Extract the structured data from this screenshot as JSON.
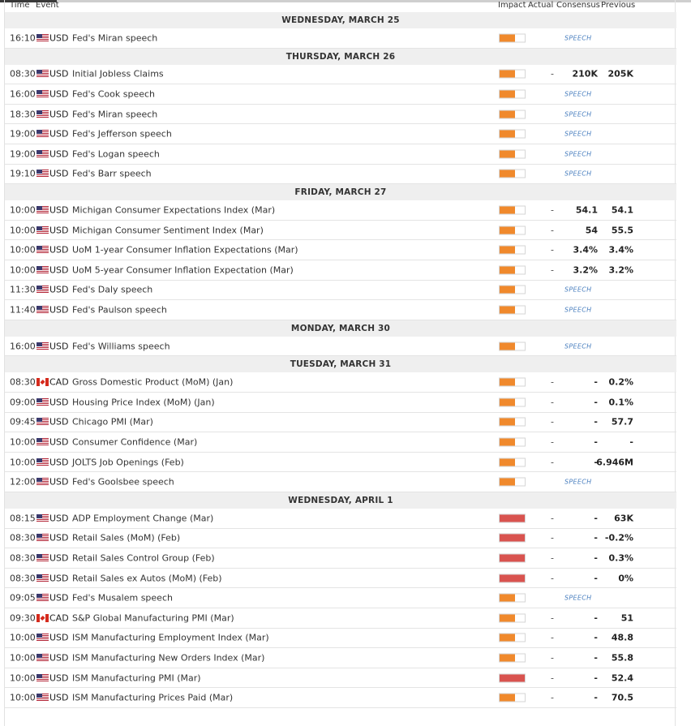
{
  "header": {
    "time": "Time",
    "event": "Event",
    "impact": "Impact",
    "actual": "Actual",
    "consensus": "Consensus",
    "previous": "Previous"
  },
  "colors": {
    "impact_medium": "#f0892c",
    "impact_high": "#d9534f",
    "speech_tag": "#4a7fbf",
    "day_header_bg": "#efefef"
  },
  "calendar": [
    {
      "type": "day",
      "label": "WEDNESDAY, MARCH 25"
    },
    {
      "type": "event",
      "time": "16:10",
      "flag": "us-flag-icon",
      "currency": "USD",
      "event": "Fed's Miran speech",
      "impact": "medium",
      "impact_level": 0.6,
      "actual": "",
      "consensus": "",
      "previous": "",
      "tag": "SPEECH"
    },
    {
      "type": "day",
      "label": "THURSDAY, MARCH 26"
    },
    {
      "type": "event",
      "time": "08:30",
      "flag": "us-flag-icon",
      "currency": "USD",
      "event": "Initial Jobless Claims",
      "impact": "medium",
      "impact_level": 0.6,
      "actual": "-",
      "consensus": "210K",
      "previous": "205K",
      "tag": ""
    },
    {
      "type": "event",
      "time": "16:00",
      "flag": "us-flag-icon",
      "currency": "USD",
      "event": "Fed's Cook speech",
      "impact": "medium",
      "impact_level": 0.6,
      "actual": "",
      "consensus": "",
      "previous": "",
      "tag": "SPEECH"
    },
    {
      "type": "event",
      "time": "18:30",
      "flag": "us-flag-icon",
      "currency": "USD",
      "event": "Fed's Miran speech",
      "impact": "medium",
      "impact_level": 0.6,
      "actual": "",
      "consensus": "",
      "previous": "",
      "tag": "SPEECH"
    },
    {
      "type": "event",
      "time": "19:00",
      "flag": "us-flag-icon",
      "currency": "USD",
      "event": "Fed's Jefferson speech",
      "impact": "medium",
      "impact_level": 0.6,
      "actual": "",
      "consensus": "",
      "previous": "",
      "tag": "SPEECH"
    },
    {
      "type": "event",
      "time": "19:00",
      "flag": "us-flag-icon",
      "currency": "USD",
      "event": "Fed's Logan speech",
      "impact": "medium",
      "impact_level": 0.6,
      "actual": "",
      "consensus": "",
      "previous": "",
      "tag": "SPEECH"
    },
    {
      "type": "event",
      "time": "19:10",
      "flag": "us-flag-icon",
      "currency": "USD",
      "event": "Fed's Barr speech",
      "impact": "medium",
      "impact_level": 0.6,
      "actual": "",
      "consensus": "",
      "previous": "",
      "tag": "SPEECH"
    },
    {
      "type": "day",
      "label": "FRIDAY, MARCH 27"
    },
    {
      "type": "event",
      "time": "10:00",
      "flag": "us-flag-icon",
      "currency": "USD",
      "event": "Michigan Consumer Expectations Index (Mar)",
      "impact": "medium",
      "impact_level": 0.6,
      "actual": "-",
      "consensus": "54.1",
      "previous": "54.1",
      "tag": ""
    },
    {
      "type": "event",
      "time": "10:00",
      "flag": "us-flag-icon",
      "currency": "USD",
      "event": "Michigan Consumer Sentiment Index (Mar)",
      "impact": "medium",
      "impact_level": 0.6,
      "actual": "-",
      "consensus": "54",
      "previous": "55.5",
      "tag": ""
    },
    {
      "type": "event",
      "time": "10:00",
      "flag": "us-flag-icon",
      "currency": "USD",
      "event": "UoM 1-year Consumer Inflation Expectations (Mar)",
      "impact": "medium",
      "impact_level": 0.6,
      "actual": "-",
      "consensus": "3.4%",
      "previous": "3.4%",
      "tag": ""
    },
    {
      "type": "event",
      "time": "10:00",
      "flag": "us-flag-icon",
      "currency": "USD",
      "event": "UoM 5-year Consumer Inflation Expectation (Mar)",
      "impact": "medium",
      "impact_level": 0.6,
      "actual": "-",
      "consensus": "3.2%",
      "previous": "3.2%",
      "tag": ""
    },
    {
      "type": "event",
      "time": "11:30",
      "flag": "us-flag-icon",
      "currency": "USD",
      "event": "Fed's Daly speech",
      "impact": "medium",
      "impact_level": 0.6,
      "actual": "",
      "consensus": "",
      "previous": "",
      "tag": "SPEECH"
    },
    {
      "type": "event",
      "time": "11:40",
      "flag": "us-flag-icon",
      "currency": "USD",
      "event": "Fed's Paulson speech",
      "impact": "medium",
      "impact_level": 0.6,
      "actual": "",
      "consensus": "",
      "previous": "",
      "tag": "SPEECH"
    },
    {
      "type": "day",
      "label": "MONDAY, MARCH 30"
    },
    {
      "type": "event",
      "time": "16:00",
      "flag": "us-flag-icon",
      "currency": "USD",
      "event": "Fed's Williams speech",
      "impact": "medium",
      "impact_level": 0.6,
      "actual": "",
      "consensus": "",
      "previous": "",
      "tag": "SPEECH"
    },
    {
      "type": "day",
      "label": "TUESDAY, MARCH 31"
    },
    {
      "type": "event",
      "time": "08:30",
      "flag": "ca-flag-icon",
      "currency": "CAD",
      "event": "Gross Domestic Product (MoM) (Jan)",
      "impact": "medium",
      "impact_level": 0.6,
      "actual": "-",
      "consensus": "-",
      "previous": "0.2%",
      "tag": ""
    },
    {
      "type": "event",
      "time": "09:00",
      "flag": "us-flag-icon",
      "currency": "USD",
      "event": "Housing Price Index (MoM) (Jan)",
      "impact": "medium",
      "impact_level": 0.6,
      "actual": "-",
      "consensus": "-",
      "previous": "0.1%",
      "tag": ""
    },
    {
      "type": "event",
      "time": "09:45",
      "flag": "us-flag-icon",
      "currency": "USD",
      "event": "Chicago PMI (Mar)",
      "impact": "medium",
      "impact_level": 0.6,
      "actual": "-",
      "consensus": "-",
      "previous": "57.7",
      "tag": ""
    },
    {
      "type": "event",
      "time": "10:00",
      "flag": "us-flag-icon",
      "currency": "USD",
      "event": "Consumer Confidence (Mar)",
      "impact": "medium",
      "impact_level": 0.6,
      "actual": "-",
      "consensus": "-",
      "previous": "-",
      "tag": ""
    },
    {
      "type": "event",
      "time": "10:00",
      "flag": "us-flag-icon",
      "currency": "USD",
      "event": "JOLTS Job Openings (Feb)",
      "impact": "medium",
      "impact_level": 0.6,
      "actual": "-",
      "consensus": "-",
      "previous": "6.946M",
      "tag": ""
    },
    {
      "type": "event",
      "time": "12:00",
      "flag": "us-flag-icon",
      "currency": "USD",
      "event": "Fed's Goolsbee speech",
      "impact": "medium",
      "impact_level": 0.6,
      "actual": "",
      "consensus": "",
      "previous": "",
      "tag": "SPEECH"
    },
    {
      "type": "day",
      "label": "WEDNESDAY, APRIL 1"
    },
    {
      "type": "event",
      "time": "08:15",
      "flag": "us-flag-icon",
      "currency": "USD",
      "event": "ADP Employment Change (Mar)",
      "impact": "high",
      "impact_level": 1.0,
      "actual": "-",
      "consensus": "-",
      "previous": "63K",
      "tag": ""
    },
    {
      "type": "event",
      "time": "08:30",
      "flag": "us-flag-icon",
      "currency": "USD",
      "event": "Retail Sales (MoM) (Feb)",
      "impact": "high",
      "impact_level": 1.0,
      "actual": "-",
      "consensus": "-",
      "previous": "-0.2%",
      "tag": ""
    },
    {
      "type": "event",
      "time": "08:30",
      "flag": "us-flag-icon",
      "currency": "USD",
      "event": "Retail Sales Control Group (Feb)",
      "impact": "high",
      "impact_level": 1.0,
      "actual": "-",
      "consensus": "-",
      "previous": "0.3%",
      "tag": ""
    },
    {
      "type": "event",
      "time": "08:30",
      "flag": "us-flag-icon",
      "currency": "USD",
      "event": "Retail Sales ex Autos (MoM) (Feb)",
      "impact": "high",
      "impact_level": 1.0,
      "actual": "-",
      "consensus": "-",
      "previous": "0%",
      "tag": ""
    },
    {
      "type": "event",
      "time": "09:05",
      "flag": "us-flag-icon",
      "currency": "USD",
      "event": "Fed's Musalem speech",
      "impact": "medium",
      "impact_level": 0.6,
      "actual": "",
      "consensus": "",
      "previous": "",
      "tag": "SPEECH"
    },
    {
      "type": "event",
      "time": "09:30",
      "flag": "ca-flag-icon",
      "currency": "CAD",
      "event": "S&P Global Manufacturing PMI (Mar)",
      "impact": "medium",
      "impact_level": 0.6,
      "actual": "-",
      "consensus": "-",
      "previous": "51",
      "tag": ""
    },
    {
      "type": "event",
      "time": "10:00",
      "flag": "us-flag-icon",
      "currency": "USD",
      "event": "ISM Manufacturing Employment Index (Mar)",
      "impact": "medium",
      "impact_level": 0.6,
      "actual": "-",
      "consensus": "-",
      "previous": "48.8",
      "tag": ""
    },
    {
      "type": "event",
      "time": "10:00",
      "flag": "us-flag-icon",
      "currency": "USD",
      "event": "ISM Manufacturing New Orders Index (Mar)",
      "impact": "medium",
      "impact_level": 0.6,
      "actual": "-",
      "consensus": "-",
      "previous": "55.8",
      "tag": ""
    },
    {
      "type": "event",
      "time": "10:00",
      "flag": "us-flag-icon",
      "currency": "USD",
      "event": "ISM Manufacturing PMI (Mar)",
      "impact": "high",
      "impact_level": 1.0,
      "actual": "-",
      "consensus": "-",
      "previous": "52.4",
      "tag": ""
    },
    {
      "type": "event",
      "time": "10:00",
      "flag": "us-flag-icon",
      "currency": "USD",
      "event": "ISM Manufacturing Prices Paid (Mar)",
      "impact": "medium",
      "impact_level": 0.6,
      "actual": "-",
      "consensus": "-",
      "previous": "70.5",
      "tag": ""
    }
  ]
}
